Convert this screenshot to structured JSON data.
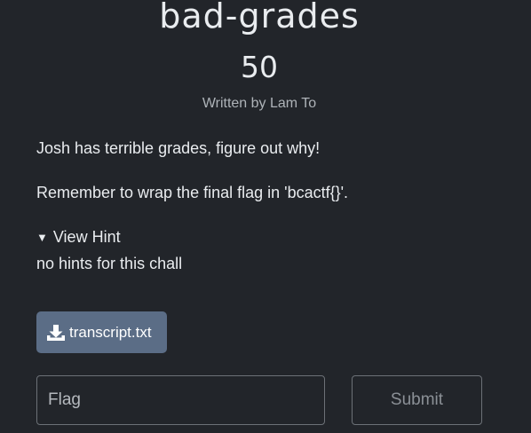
{
  "challenge": {
    "title": "bad-grades",
    "points": "50",
    "author": "Written by Lam To",
    "description": [
      "Josh has terrible grades, figure out why!",
      "Remember to wrap the final flag in 'bcactf{}'."
    ],
    "hint": {
      "toggle_label": "View Hint",
      "toggle_icon": "triangle-down-icon",
      "text": "no hints for this chall"
    },
    "attachment": {
      "icon": "download-icon",
      "label": "transcript.txt"
    }
  },
  "flag_form": {
    "input_placeholder": "Flag",
    "input_value": "",
    "submit_label": "Submit"
  },
  "colors": {
    "background": "#22252a",
    "text": "#e9ecef",
    "muted_text": "#aeb3b8",
    "download_button": "#5b6d86",
    "border": "#6c7177"
  }
}
